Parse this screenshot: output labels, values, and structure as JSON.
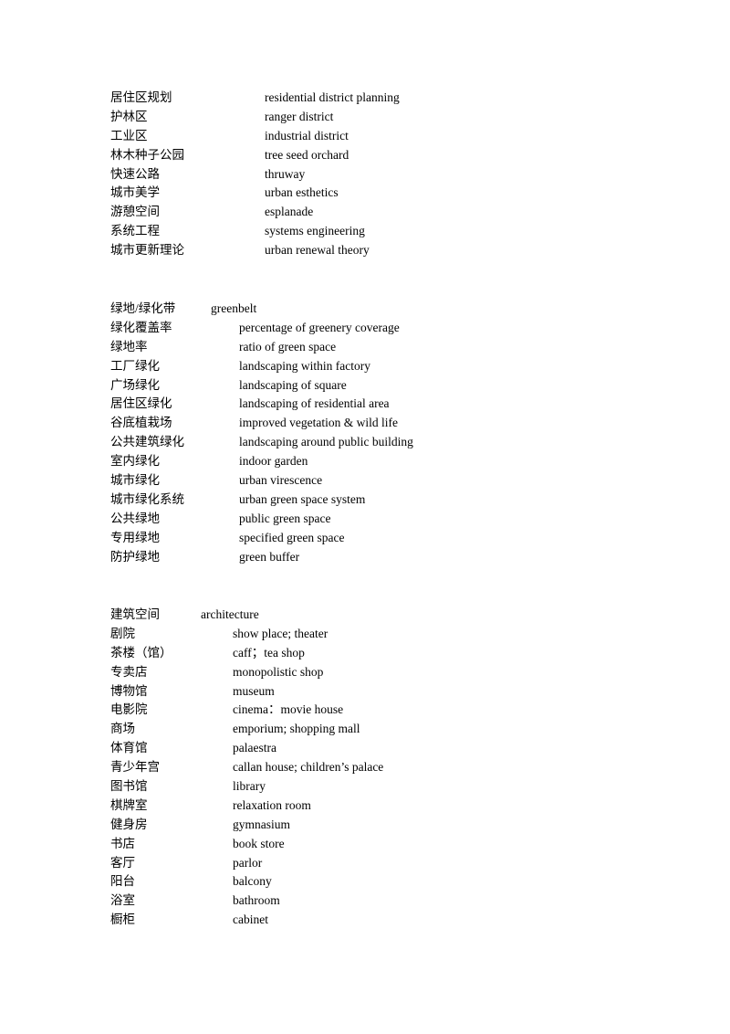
{
  "sections": [
    {
      "entries": [
        {
          "zh": "居住区规划",
          "en": "residential district planning"
        },
        {
          "zh": "护林区",
          "en": "ranger district"
        },
        {
          "zh": "工业区",
          "en": "industrial district"
        },
        {
          "zh": "林木种子公园",
          "en": "tree seed orchard"
        },
        {
          "zh": "快速公路",
          "en": "thruway"
        },
        {
          "zh": "城市美学",
          "en": "urban esthetics"
        },
        {
          "zh": "游憩空间",
          "en": "esplanade"
        },
        {
          "zh": "系统工程",
          "en": "systems engineering"
        },
        {
          "zh": "城市更新理论",
          "en": "urban renewal theory"
        }
      ]
    },
    {
      "heading": {
        "zh": "绿地/绿化带",
        "en": "greenbelt"
      },
      "entries": [
        {
          "zh": "绿化覆盖率",
          "en": "percentage of greenery coverage"
        },
        {
          "zh": "绿地率",
          "en": "ratio of green space"
        },
        {
          "zh": "工厂绿化",
          "en": "landscaping within factory"
        },
        {
          "zh": "广场绿化",
          "en": "landscaping of square"
        },
        {
          "zh": "居住区绿化",
          "en": "landscaping of residential area"
        },
        {
          "zh": "谷底植栽场",
          "en": "improved vegetation & wild life"
        },
        {
          "zh": "公共建筑绿化",
          "en": "landscaping around public building"
        },
        {
          "zh": "室内绿化",
          "en": "indoor garden"
        },
        {
          "zh": "城市绿化",
          "en": "urban virescence"
        },
        {
          "zh": "城市绿化系统",
          "en": "urban green space system"
        },
        {
          "zh": "公共绿地",
          "en": "public green space"
        },
        {
          "zh": "专用绿地",
          "en": "specified green space"
        },
        {
          "zh": "防护绿地",
          "en": "green buffer"
        }
      ]
    },
    {
      "heading": {
        "zh": "建筑空间",
        "en": "architecture"
      },
      "entries": [
        {
          "zh": "剧院",
          "en": "show place; theater"
        },
        {
          "zh": "茶楼（馆）",
          "en": "caff；tea shop"
        },
        {
          "zh": "专卖店",
          "en": "monopolistic shop"
        },
        {
          "zh": "博物馆",
          "en": "museum"
        },
        {
          "zh": "电影院",
          "en": "cinema：movie house"
        },
        {
          "zh": "商场",
          "en": "emporium; shopping mall"
        },
        {
          "zh": "体育馆",
          "en": "palaestra"
        },
        {
          "zh": "青少年宫",
          "en": "callan house; children’s palace"
        },
        {
          "zh": "图书馆",
          "en": "library"
        },
        {
          "zh": "棋牌室",
          "en": "relaxation room"
        },
        {
          "zh": "健身房",
          "en": "gymnasium"
        },
        {
          "zh": "书店",
          "en": "book store"
        },
        {
          "zh": "客厅",
          "en": "parlor"
        },
        {
          "zh": "阳台",
          "en": "balcony"
        },
        {
          "zh": "浴室",
          "en": "bathroom"
        },
        {
          "zh": "橱柜",
          "en": "cabinet"
        }
      ]
    }
  ]
}
